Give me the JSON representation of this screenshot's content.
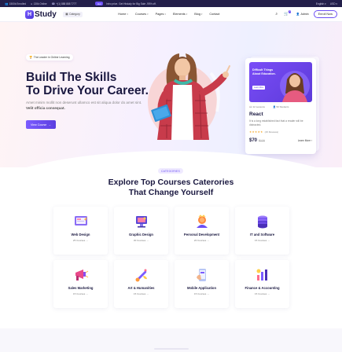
{
  "topbar": {
    "students": "1500k Enrolled",
    "online": "130k Online",
    "phone": "+(1) 888 888 7777",
    "hot_label": "Hot",
    "promo": "Intro price. Get Histudy for Big Sale -95% off.",
    "language": "English",
    "currency": "USD",
    "social": "f t in"
  },
  "header": {
    "logo_mark": "H",
    "logo_text": "Study",
    "category_label": "Category",
    "nav": [
      "Home",
      "Courses",
      "Pages",
      "Elements",
      "Blog",
      "Contact"
    ],
    "admin_label": "Admin",
    "cart_count": "0",
    "enroll_label": "Enroll Now"
  },
  "hero": {
    "badge": "The Leader in Online Learning",
    "title_line1": "Build The Skills",
    "title_line2": "To Drive Your Career.",
    "subtitle": "Amet minim mollit non deserunt ullamco est sit aliqua dolor do amet sint.",
    "subtitle_bold": "Velit officia consequat.",
    "button_label": "View Course"
  },
  "course_card": {
    "image_text": "Difficult Things About Education.",
    "image_button": "Learn More",
    "lessons": "12 Lessons",
    "students": "50 Students",
    "title": "React",
    "description": "It is a long established fact that a reader will be distracted.",
    "stars": "★★★★★",
    "reviews": "(15 Reviews)",
    "price": "$70",
    "old_price": "$120",
    "learn_more": "Learn More"
  },
  "categories": {
    "pill": "CATEGORIES",
    "heading_line1": "Explore Top Courses Caterories",
    "heading_line2": "That Change Yourself",
    "items": [
      {
        "name": "Web Design",
        "count": "25 Courses",
        "icon": "web-design"
      },
      {
        "name": "Graphic Design",
        "count": "30 Courses",
        "icon": "graphic-design"
      },
      {
        "name": "Personal Development",
        "count": "20 Courses",
        "icon": "personal-development"
      },
      {
        "name": "IT and Software",
        "count": "15 Courses",
        "icon": "it-software"
      },
      {
        "name": "Sales Marketing",
        "count": "15 Courses",
        "icon": "sales-marketing"
      },
      {
        "name": "Art & Humanities",
        "count": "15 Courses",
        "icon": "art-humanities"
      },
      {
        "name": "Mobile Application",
        "count": "15 Courses",
        "icon": "mobile-application"
      },
      {
        "name": "Finance & Accounting",
        "count": "15 Courses",
        "icon": "finance-accounting"
      }
    ]
  },
  "colors": {
    "primary": "#6c4ff5",
    "dark": "#1a1840",
    "topbar": "#231f4a"
  }
}
